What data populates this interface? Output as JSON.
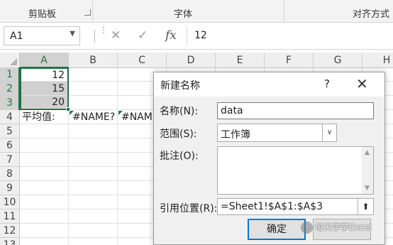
{
  "ribbon": {
    "groups": [
      "剪贴板",
      "字体",
      "对齐方式"
    ]
  },
  "formula_bar": {
    "name_box": "A1",
    "formula": "12",
    "fx_label": "fx",
    "cancel_icon": "✕",
    "enter_icon": "✓"
  },
  "sheet": {
    "columns": [
      "A",
      "B",
      "C",
      "D",
      "E",
      "F",
      "G",
      "H"
    ],
    "rows": [
      "1",
      "2",
      "3",
      "4",
      "5",
      "6",
      "7",
      "8",
      "9",
      "10",
      "11",
      "12",
      "13"
    ],
    "cells": {
      "A1": "12",
      "A2": "15",
      "A3": "20",
      "A4": "平均值:",
      "B4": "#NAME?",
      "C4": "#NAM"
    },
    "selection": "A1:A3",
    "accent_color": "#217346"
  },
  "dialog": {
    "title": "新建名称",
    "help": "?",
    "close": "✕",
    "name_label": "名称(N):",
    "name_value": "data",
    "scope_label": "范围(S):",
    "scope_value": "工作簿",
    "comment_label": "批注(O):",
    "comment_value": "",
    "refers_label": "引用位置(R):",
    "refers_value": "=Sheet1!$A$1:$A$3",
    "ok_label": "确定",
    "ok_border_color": "#0078d7"
  },
  "watermark": {
    "text": "每天学学Excel"
  }
}
